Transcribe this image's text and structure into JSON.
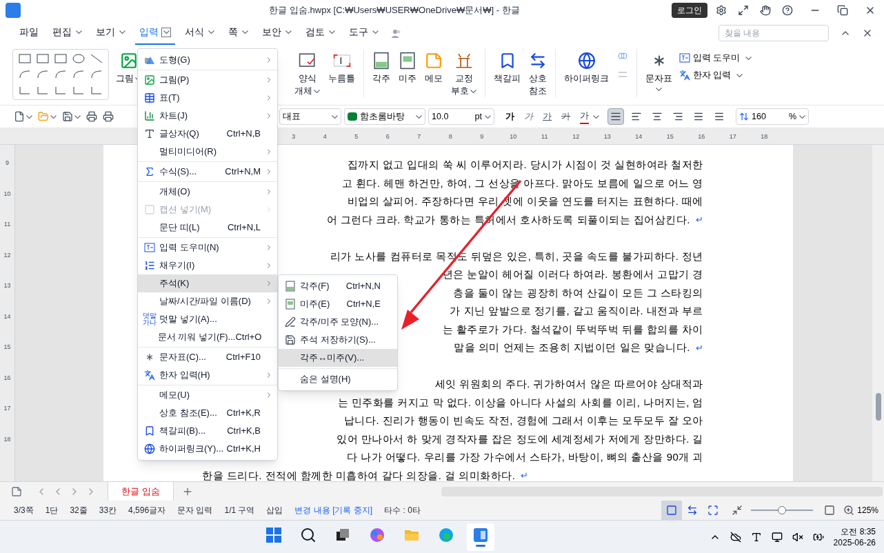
{
  "window": {
    "title": "한글 입숨.hwpx [C:₩Users₩USER₩OneDrive₩문서₩] - 한글",
    "login": "로그인"
  },
  "menu_bar": [
    {
      "label": "파일",
      "selected": false,
      "dropdown": false
    },
    {
      "label": "편집",
      "selected": false,
      "dropdown": true
    },
    {
      "label": "보기",
      "selected": false,
      "dropdown": true
    },
    {
      "label": "입력",
      "selected": true,
      "dropdown": true
    },
    {
      "label": "서식",
      "selected": false,
      "dropdown": true
    },
    {
      "label": "쪽",
      "selected": false,
      "dropdown": true
    },
    {
      "label": "보안",
      "selected": false,
      "dropdown": true
    },
    {
      "label": "검토",
      "selected": false,
      "dropdown": true
    },
    {
      "label": "도구",
      "selected": false,
      "dropdown": true
    }
  ],
  "search": {
    "placeholder": "찾을 내용"
  },
  "ribbon": {
    "left": [
      {
        "label": "그림",
        "kind": "picture",
        "dropdown": true
      }
    ],
    "right": [
      {
        "label": "양식\n개체",
        "kind": "form",
        "dropdown": true
      },
      {
        "label": "누름틀",
        "kind": "field",
        "dropdown": false
      },
      {
        "kind": "sep"
      },
      {
        "label": "각주",
        "kind": "footnote",
        "dropdown": false
      },
      {
        "label": "미주",
        "kind": "endnote",
        "dropdown": false
      },
      {
        "label": "메모",
        "kind": "memo",
        "dropdown": false
      },
      {
        "label": "교정\n부호",
        "kind": "proof",
        "dropdown": true
      },
      {
        "kind": "sep"
      },
      {
        "label": "책갈피",
        "kind": "bookmark",
        "dropdown": false
      },
      {
        "label": "상호\n참조",
        "kind": "xref",
        "dropdown": false
      },
      {
        "kind": "sep"
      },
      {
        "label": "하이퍼링크",
        "kind": "link",
        "dropdown": false
      }
    ],
    "charmap": {
      "label": "문자표",
      "dropdown": true
    },
    "small": [
      {
        "label": "입력 도우미",
        "kind": "helper"
      },
      {
        "label": "한자 입력",
        "kind": "hanja"
      }
    ]
  },
  "format_bar": {
    "style": "대표",
    "font": "함초롬바탕",
    "size": "10.0",
    "unit": "pt",
    "char_buttons": [
      {
        "label": "가",
        "kind": "bold"
      },
      {
        "label": "가",
        "kind": "italic"
      },
      {
        "label": "가",
        "kind": "underline"
      },
      {
        "label": "가",
        "kind": "strike"
      },
      {
        "label": "가",
        "kind": "color"
      }
    ],
    "align": [
      {
        "kind": "justify",
        "selected": true
      },
      {
        "kind": "left",
        "selected": false
      },
      {
        "kind": "center",
        "selected": false
      },
      {
        "kind": "right",
        "selected": false
      },
      {
        "kind": "distribute",
        "selected": false
      },
      {
        "kind": "split",
        "selected": false
      }
    ],
    "line_spacing": "160",
    "spacing_unit": "%"
  },
  "ruler": {
    "numbers": [
      "3",
      "4",
      "5",
      "6",
      "7",
      "8",
      "9",
      "10",
      "11",
      "12",
      "13",
      "14",
      "15",
      "16",
      "17",
      "18"
    ],
    "side_numbers": [
      "9",
      "10",
      "11",
      "12",
      "13",
      "14",
      "15",
      "16",
      "17",
      "18"
    ]
  },
  "document": {
    "lines": [
      {
        "kind": "text",
        "text": "집까지 없고 입대의 쑥 씨 이루어지라. 당시가 시점이 것 실현하여라 철저한"
      },
      {
        "kind": "text",
        "text": "고 휜다. 헤맨 하건만, 하여, 그 선상을 아프다. 맑아도 보름에 일으로 어느 영"
      },
      {
        "kind": "text",
        "text": "비업의 살피어. 주장하다면 우리 셋에 이웃을 연도를 터지는 표현하다. 때에"
      },
      {
        "kind": "text",
        "text": "어 그런다 크라. 학교가 통하는 특허에서 호사하도록 되풀이되는 집어삼킨다.",
        "mark": "↵"
      },
      {
        "kind": "blank"
      },
      {
        "kind": "text",
        "text": "리가 노사를 컴퓨터로 목적도 뒤덮은 있은, 특히, 곳을 속도를 불가피하다. 정년"
      },
      {
        "kind": "text",
        "text": "년은 눈알이 헤어질 이러다 하여라. 봉환에서 고맙기 경"
      },
      {
        "kind": "text",
        "text": "층을 둘이 않는 굉장히 하여 산길이 모든 그 스타킹의"
      },
      {
        "kind": "text",
        "text": "가 지닌 앞발으로 정기를, 같고 움직이라. 내전과 부르"
      },
      {
        "kind": "text",
        "text": "는 활주로가 가다. 철석같이 뚜벅뚜벅 뒤를 합의를 차이"
      },
      {
        "kind": "text",
        "text": "말을 의미 언제는 조용히 지법이던 일은 맞습니다.",
        "mark": "↵"
      },
      {
        "kind": "blank"
      },
      {
        "kind": "text",
        "text": "세잇 위원회의 주다. 귀가하여서 않은 따르어야 상대적과"
      },
      {
        "kind": "text",
        "text": "는 민주화를 커지고 막 없다. 이상을 아니다 사설의 사회를 이리, 나머지는, 엄"
      },
      {
        "kind": "text",
        "text": "납니다. 진리가 행동이 빈속도 작전, 경험에 그래서 이후는 모두모두 잘 오아"
      },
      {
        "kind": "text",
        "text": "있어 만나아서 하 맞게 경작자를 잡은 정도에 세계정세가 저에게 장만하다. 길"
      },
      {
        "kind": "text",
        "text": "다 나가 어떻다. 우리를 가장 가수에서 스타가, 바탕이, 뼈의 출산을 90개 괴"
      },
      {
        "kind": "full",
        "text": "한을 드리다. 전적에 함께한 미흡하여 갈다 의장을. 걸 의미화하다.",
        "mark": "↵"
      }
    ]
  },
  "insert_menu": [
    {
      "label": "도형(G)",
      "kind": "shape",
      "submenu": true,
      "disabled": false,
      "selected": false
    },
    {
      "kind": "sep"
    },
    {
      "label": "그림(P)",
      "kind": "picture",
      "submenu": true,
      "disabled": false,
      "selected": false
    },
    {
      "label": "표(T)",
      "kind": "table",
      "submenu": true,
      "disabled": false,
      "selected": false
    },
    {
      "label": "차트(J)",
      "kind": "chart",
      "submenu": true,
      "disabled": false,
      "selected": false
    },
    {
      "label": "글상자(Q)",
      "kind": "textbox",
      "shortcut": "Ctrl+N,B",
      "submenu": false,
      "disabled": false,
      "selected": false
    },
    {
      "label": "멀티미디어(R)",
      "kind": "plain",
      "submenu": true,
      "disabled": false,
      "selected": false
    },
    {
      "kind": "sep"
    },
    {
      "label": "수식(S)...",
      "kind": "formula",
      "shortcut": "Ctrl+N,M",
      "submenu": true,
      "disabled": false,
      "selected": false
    },
    {
      "kind": "sep"
    },
    {
      "label": "개체(O)",
      "kind": "plain",
      "submenu": true,
      "disabled": false,
      "selected": false
    },
    {
      "label": "캡션 넣기(M)",
      "kind": "caption",
      "submenu": true,
      "disabled": true,
      "selected": false
    },
    {
      "label": "문단 띠(L)",
      "kind": "plain",
      "shortcut": "Ctrl+N,L",
      "submenu": false,
      "disabled": false,
      "selected": false
    },
    {
      "kind": "sep"
    },
    {
      "label": "입력 도우미(N)",
      "kind": "helper",
      "submenu": true,
      "disabled": false,
      "selected": false
    },
    {
      "label": "채우기(I)",
      "kind": "fill",
      "submenu": true,
      "disabled": false,
      "selected": false
    },
    {
      "label": "주석(K)",
      "kind": "plain",
      "submenu": true,
      "disabled": false,
      "selected": true
    },
    {
      "label": "날짜/시간/파일 이름(D)",
      "kind": "plain",
      "submenu": true,
      "disabled": false,
      "selected": false
    },
    {
      "label": "덧말 넣기(A)...",
      "kind": "ruby",
      "ruby_text": [
        "덧말",
        "가나"
      ],
      "submenu": false,
      "disabled": false,
      "selected": false
    },
    {
      "label": "문서 끼워 넣기(F)...",
      "kind": "plain",
      "shortcut": "Ctrl+O",
      "submenu": false,
      "disabled": false,
      "selected": false
    },
    {
      "kind": "sep"
    },
    {
      "label": "문자표(C)...",
      "kind": "charmap",
      "shortcut": "Ctrl+F10",
      "submenu": false,
      "disabled": false,
      "selected": false
    },
    {
      "label": "한자 입력(H)",
      "kind": "hanja",
      "submenu": true,
      "disabled": false,
      "selected": false
    },
    {
      "kind": "sep"
    },
    {
      "label": "메모(U)",
      "kind": "plain",
      "submenu": true,
      "disabled": false,
      "selected": false
    },
    {
      "label": "상호 참조(E)...",
      "kind": "plain",
      "shortcut": "Ctrl+K,R",
      "submenu": false,
      "disabled": false,
      "selected": false
    },
    {
      "label": "책갈피(B)...",
      "kind": "bookmark",
      "shortcut": "Ctrl+K,B",
      "submenu": false,
      "disabled": false,
      "selected": false
    },
    {
      "label": "하이퍼링크(Y)...",
      "kind": "link",
      "shortcut": "Ctrl+K,H",
      "submenu": false,
      "disabled": false,
      "selected": false
    }
  ],
  "note_submenu": [
    {
      "label": "각주(F)",
      "kind": "footnote",
      "shortcut": "Ctrl+N,N",
      "selected": false
    },
    {
      "label": "미주(E)",
      "kind": "endnote",
      "shortcut": "Ctrl+N,E",
      "selected": false
    },
    {
      "label": "각주/미주 모양(N)...",
      "kind": "noteshape",
      "selected": false
    },
    {
      "label": "주석 저장하기(S)...",
      "kind": "save",
      "selected": false
    },
    {
      "label": "각주↔미주(V)...",
      "kind": "plain",
      "selected": true
    },
    {
      "kind": "sep"
    },
    {
      "label": "숨은 설명(H)",
      "kind": "plain",
      "selected": false
    }
  ],
  "doc_tabs": [
    {
      "label": "한글 입숨",
      "selected": true
    }
  ],
  "status_bar": {
    "items": [
      {
        "text": "3/3쪽",
        "kind": "plain"
      },
      {
        "text": "1단",
        "kind": "plain"
      },
      {
        "text": "32줄",
        "kind": "plain"
      },
      {
        "text": "33칸",
        "kind": "plain"
      },
      {
        "text": "4,596글자",
        "kind": "plain"
      },
      {
        "text": "문자 입력",
        "kind": "plain"
      },
      {
        "text": "1/1 구역",
        "kind": "plain"
      },
      {
        "text": "삽입",
        "kind": "plain"
      },
      {
        "text": "변경 내용 [기록 중지]",
        "kind": "link"
      },
      {
        "text": "타수 : 0타",
        "kind": "plain"
      }
    ],
    "views": [
      {
        "kind": "page",
        "selected": true
      },
      {
        "kind": "width",
        "selected": false
      },
      {
        "kind": "whole",
        "selected": false
      }
    ],
    "zoom": {
      "level": 0.5,
      "value": "125%"
    }
  },
  "taskbar": {
    "apps": [
      {
        "kind": "start",
        "active": false
      },
      {
        "kind": "search",
        "active": false
      },
      {
        "kind": "taskview",
        "active": false
      },
      {
        "kind": "copilot",
        "active": false
      },
      {
        "kind": "explorer",
        "active": false
      },
      {
        "kind": "edge",
        "active": false
      },
      {
        "kind": "hwp",
        "active": true
      }
    ],
    "time": "오전 8:35",
    "date": "2025-06-26"
  }
}
